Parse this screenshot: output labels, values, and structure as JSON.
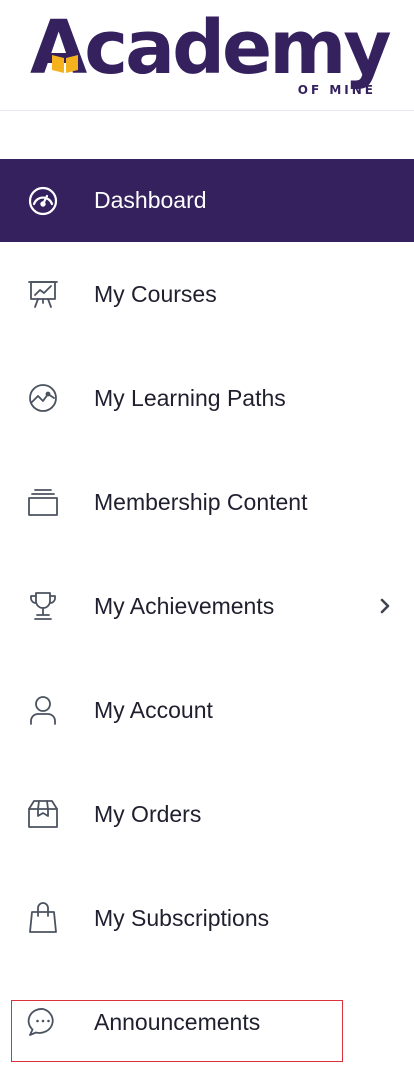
{
  "brand": {
    "name": "Academy",
    "tagline": "OF MINE",
    "primary_color": "#34215e",
    "accent_color": "#f5b21f"
  },
  "menu": {
    "items": [
      {
        "label": "Dashboard",
        "icon": "speedometer-icon",
        "active": true
      },
      {
        "label": "My Courses",
        "icon": "presentation-chart-icon"
      },
      {
        "label": "My Learning Paths",
        "icon": "chart-circle-icon"
      },
      {
        "label": "Membership Content",
        "icon": "stacked-layers-icon"
      },
      {
        "label": "My Achievements",
        "icon": "trophy-icon",
        "has_submenu": true
      },
      {
        "label": "My Account",
        "icon": "user-icon"
      },
      {
        "label": "My Orders",
        "icon": "package-icon"
      },
      {
        "label": "My Subscriptions",
        "icon": "shopping-bag-icon"
      },
      {
        "label": "Announcements",
        "icon": "chat-bubble-icon",
        "highlighted": true
      }
    ]
  },
  "highlight_color": "#d9323c"
}
